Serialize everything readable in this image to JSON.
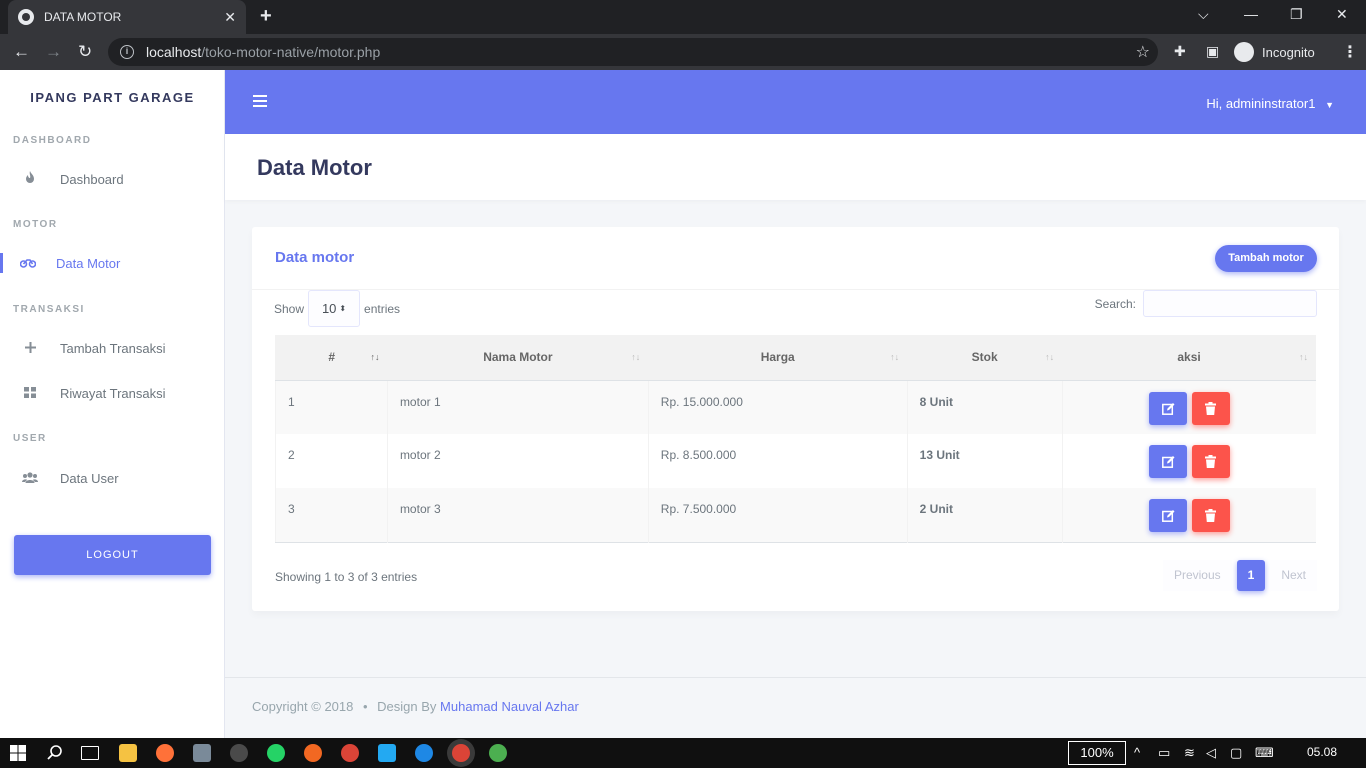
{
  "browser": {
    "tab_title": "DATA MOTOR",
    "url_host": "localhost",
    "url_path": "/toko-motor-native/motor.php",
    "incognito_label": "Incognito"
  },
  "sidebar": {
    "brand": "IPANG PART GARAGE",
    "sections": [
      {
        "heading": "DASHBOARD",
        "items": [
          {
            "label": "Dashboard",
            "icon": "fire-icon"
          }
        ]
      },
      {
        "heading": "MOTOR",
        "items": [
          {
            "label": "Data Motor",
            "icon": "motorcycle-icon",
            "active": true
          }
        ]
      },
      {
        "heading": "TRANSAKSI",
        "items": [
          {
            "label": "Tambah Transaksi",
            "icon": "plus-icon"
          },
          {
            "label": "Riwayat Transaksi",
            "icon": "grid-icon"
          }
        ]
      },
      {
        "heading": "USER",
        "items": [
          {
            "label": "Data User",
            "icon": "users-icon"
          }
        ]
      }
    ],
    "logout_label": "LOGOUT"
  },
  "topbar": {
    "user_greeting": "Hi, admininstrator1"
  },
  "page": {
    "title": "Data Motor"
  },
  "card": {
    "title": "Data motor",
    "add_button": "Tambah motor",
    "length": {
      "show": "Show",
      "value": "10",
      "entries": "entries"
    },
    "search_label": "Search:",
    "columns": [
      "#",
      "Nama Motor",
      "Harga",
      "Stok",
      "aksi"
    ],
    "rows": [
      {
        "no": "1",
        "nama": "motor 1",
        "harga": "Rp. 15.000.000",
        "stok": "8 Unit"
      },
      {
        "no": "2",
        "nama": "motor 2",
        "harga": "Rp. 8.500.000",
        "stok": "13 Unit"
      },
      {
        "no": "3",
        "nama": "motor 3",
        "harga": "Rp. 7.500.000",
        "stok": "2 Unit"
      }
    ],
    "info": "Showing 1 to 3 of 3 entries",
    "pagination": {
      "previous": "Previous",
      "current": "1",
      "next": "Next"
    }
  },
  "footer": {
    "copyright": "Copyright © 2018",
    "separator": "•",
    "design_by": "Design By",
    "author": "Muhamad Nauval Azhar"
  },
  "taskbar": {
    "zoom": "100%",
    "time": "05.08"
  },
  "colors": {
    "primary": "#6777ef",
    "danger": "#fc544b"
  }
}
